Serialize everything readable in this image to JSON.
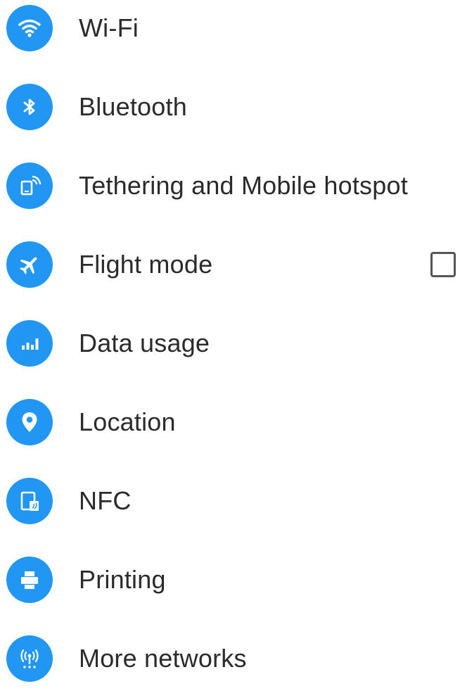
{
  "theme": {
    "accent": "#2196F3",
    "text": "#2b2b2b"
  },
  "settings": {
    "items": [
      {
        "label": "Wi-Fi",
        "icon": "wifi-icon"
      },
      {
        "label": "Bluetooth",
        "icon": "bluetooth-icon"
      },
      {
        "label": "Tethering and Mobile hotspot",
        "icon": "hotspot-icon"
      },
      {
        "label": "Flight mode",
        "icon": "airplane-icon",
        "checked": false
      },
      {
        "label": "Data usage",
        "icon": "data-usage-icon"
      },
      {
        "label": "Location",
        "icon": "location-pin-icon"
      },
      {
        "label": "NFC",
        "icon": "nfc-icon"
      },
      {
        "label": "Printing",
        "icon": "printer-icon"
      },
      {
        "label": "More networks",
        "icon": "antenna-icon"
      }
    ]
  }
}
